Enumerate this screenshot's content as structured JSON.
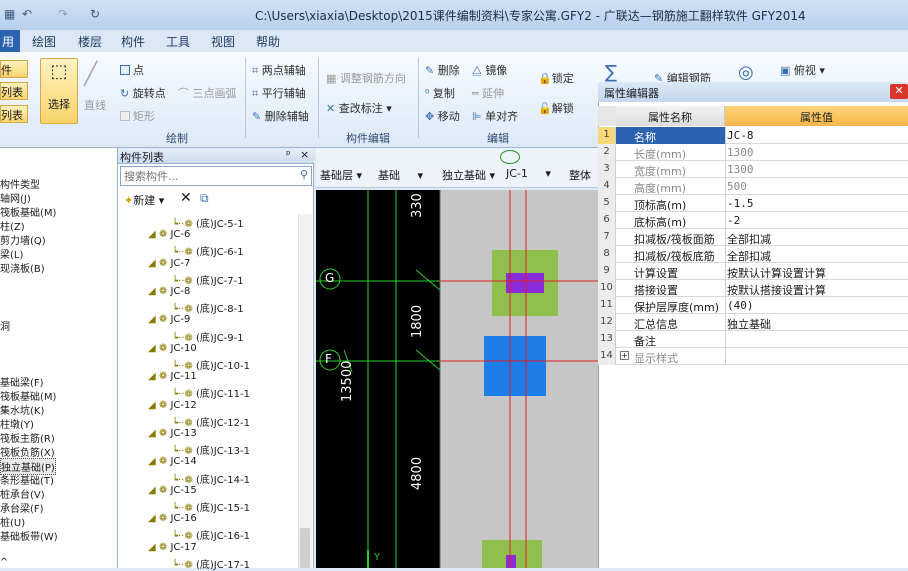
{
  "window": {
    "title": "C:\\Users\\xiaxia\\Desktop\\2015课件编制资料\\专家公寓.GFY2 - 广联达—钢筋施工翻样软件 GFY2014"
  },
  "menu": {
    "home": "用",
    "items": [
      "绘图",
      "楼层",
      "构件",
      "工具",
      "视图",
      "帮助"
    ]
  },
  "ribbon": {
    "left_buttons": [
      "件",
      "列表",
      "列表"
    ],
    "select": "选择",
    "line": "直线",
    "draw": {
      "point": "点",
      "rotate_point": "旋转点",
      "three_arc": "三点画弧",
      "rect": "矩形",
      "group": "绘制"
    },
    "axis": {
      "two_point": "两点辅轴",
      "parallel": "平行辅轴",
      "delete": "删除辅轴"
    },
    "comp_edit": {
      "adjust": "调整钢筋方向",
      "check": "查改标注",
      "group": "构件编辑"
    },
    "edit": {
      "delete": "删除",
      "mirror": "镜像",
      "copy": "复制",
      "extend": "延伸",
      "move": "移动",
      "align": "单对齐",
      "lock": "锁定",
      "unlock": "解锁",
      "group": "编辑"
    },
    "right": {
      "edit_rebar": "编辑钢筋",
      "view": "俯视"
    }
  },
  "left_types": [
    "构件类型",
    "轴网(J)",
    "筏板基础(M)",
    "柱(Z)",
    "剪力墙(Q)",
    "梁(L)",
    "现浇板(B)",
    "洞",
    "基础梁(F)",
    "筏板基础(M)",
    "集水坑(K)",
    "柱墩(Y)",
    "筏板主筋(R)",
    "筏板负筋(X)",
    "独立基础(P)",
    "条形基础(T)",
    "桩承台(V)",
    "承台梁(F)",
    "桩(U)",
    "基础板带(W)",
    "^"
  ],
  "comp_list": {
    "title": "构件列表",
    "pin": "ᵖ",
    "close": "×",
    "search_placeholder": "搜索构件...",
    "new_label": "新建"
  },
  "tree": [
    {
      "t": "(底)JC-5-1",
      "c": true
    },
    {
      "t": "JC-6",
      "c": false
    },
    {
      "t": "(底)JC-6-1",
      "c": true
    },
    {
      "t": "JC-7",
      "c": false
    },
    {
      "t": "(底)JC-7-1",
      "c": true
    },
    {
      "t": "JC-8",
      "c": false
    },
    {
      "t": "(底)JC-8-1",
      "c": true
    },
    {
      "t": "JC-9",
      "c": false
    },
    {
      "t": "(底)JC-9-1",
      "c": true
    },
    {
      "t": "JC-10",
      "c": false
    },
    {
      "t": "(底)JC-10-1",
      "c": true
    },
    {
      "t": "JC-11",
      "c": false
    },
    {
      "t": "(底)JC-11-1",
      "c": true
    },
    {
      "t": "JC-12",
      "c": false
    },
    {
      "t": "(底)JC-12-1",
      "c": true
    },
    {
      "t": "JC-13",
      "c": false
    },
    {
      "t": "(底)JC-13-1",
      "c": true
    },
    {
      "t": "JC-14",
      "c": false
    },
    {
      "t": "(底)JC-14-1",
      "c": true
    },
    {
      "t": "JC-15",
      "c": false
    },
    {
      "t": "(底)JC-15-1",
      "c": true
    },
    {
      "t": "JC-16",
      "c": false
    },
    {
      "t": "(底)JC-16-1",
      "c": true
    },
    {
      "t": "JC-17",
      "c": false
    },
    {
      "t": "(底)JC-17-1",
      "c": true
    }
  ],
  "canvas": {
    "floor": "基础层",
    "layer": "基础",
    "type": "独立基础",
    "comp": "JC-1",
    "extra": "整体",
    "dim_top": "330",
    "dim_1800": "1800",
    "dim_13500": "13500",
    "dim_4800": "4800",
    "axis_g": "G",
    "axis_f": "F",
    "axis_y": "Y"
  },
  "prop": {
    "title": "属性编辑器",
    "col_name": "属性名称",
    "col_value": "属性值",
    "rows": [
      {
        "n": "1",
        "name": "名称",
        "value": "JC-8",
        "gray": false
      },
      {
        "n": "2",
        "name": "长度(mm)",
        "value": "1300",
        "gray": true
      },
      {
        "n": "3",
        "name": "宽度(mm)",
        "value": "1300",
        "gray": true
      },
      {
        "n": "4",
        "name": "高度(mm)",
        "value": "500",
        "gray": true
      },
      {
        "n": "5",
        "name": "顶标高(m)",
        "value": "-1.5",
        "gray": false
      },
      {
        "n": "6",
        "name": "底标高(m)",
        "value": "-2",
        "gray": false
      },
      {
        "n": "7",
        "name": "扣减板/筏板面筋",
        "value": "全部扣减",
        "gray": false
      },
      {
        "n": "8",
        "name": "扣减板/筏板底筋",
        "value": "全部扣减",
        "gray": false
      },
      {
        "n": "9",
        "name": "计算设置",
        "value": "按默认计算设置计算",
        "gray": false
      },
      {
        "n": "10",
        "name": "搭接设置",
        "value": "按默认搭接设置计算",
        "gray": false
      },
      {
        "n": "11",
        "name": "保护层厚度(mm)",
        "value": "(40)",
        "gray": false
      },
      {
        "n": "12",
        "name": "汇总信息",
        "value": "独立基础",
        "gray": false
      },
      {
        "n": "13",
        "name": "备注",
        "value": "",
        "gray": false
      },
      {
        "n": "14",
        "name": "显示样式",
        "value": "",
        "gray": true
      }
    ]
  }
}
